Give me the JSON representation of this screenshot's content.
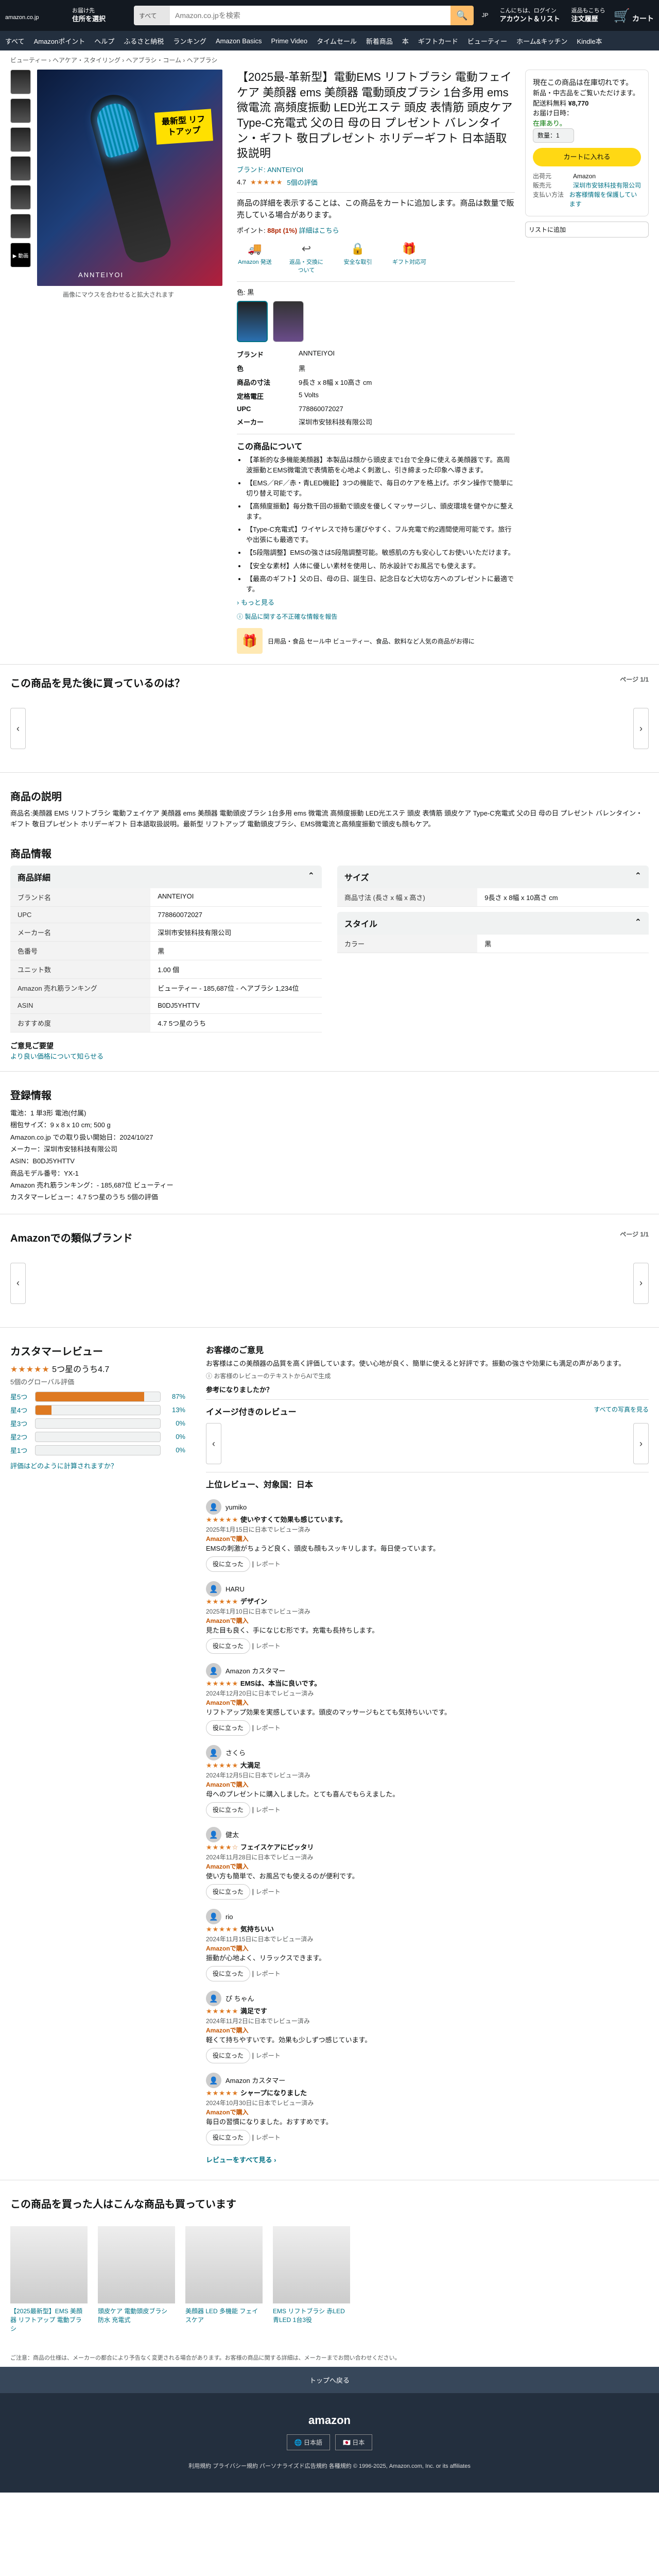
{
  "header": {
    "logo": "amazon",
    "logo_suffix": ".co.jp",
    "deliver_line1": "お届け先",
    "deliver_line2": "住所を選択",
    "search_category": "すべて",
    "search_placeholder": "Amazon.co.jpを検索",
    "lang": "JP",
    "account_line1": "こんにちは、ログイン",
    "account_line2": "アカウント＆リスト",
    "orders_line1": "返品もこちら",
    "orders_line2": "注文履歴",
    "cart": "カート"
  },
  "nav": [
    "すべて",
    "Amazonポイント",
    "ヘルプ",
    "ふるさと納税",
    "ランキング",
    "Amazon Basics",
    "Prime Video",
    "タイムセール",
    "新着商品",
    "本",
    "ギフトカード",
    "ビューティー",
    "ホーム&キッチン",
    "Kindle本"
  ],
  "breadcrumb": "ビューティー › ヘアケア・スタイリング › ヘアブラシ・コーム › ヘアブラシ",
  "gallery": {
    "thumb_video": "▶ 動画",
    "tag": "最新型 リフトアップ",
    "brand": "ANNTEIYOI",
    "hover": "画像にマウスを合わせると拡大されます"
  },
  "product": {
    "title": "【2025最-革新型】電動EMS リフトブラシ 電動フェイケア 美顔器 ems 美顔器 電動頭皮ブラシ 1台多用 ems 微電流 高頻度振動 LED光エステ 頭皮 表情筋 頭皮ケア Type-C充電式 父の日 母の日 プレゼント バレンタイン・ギフト 敬日プレゼント ホリデーギフト 日本語取扱説明",
    "visit": "ブランド: ANNTEIYOI",
    "rating": "4.7",
    "rating_count": "5個の評価",
    "unavailable": "商品の詳細を表示することは、この商品をカートに追加します。商品は数量で販売している場合があります。",
    "points_label": "ポイント:",
    "points_value": "88pt (1%)",
    "points_note": "詳細はこちら",
    "icons": [
      {
        "icon": "truck-icon",
        "glyph": "🚚",
        "label": "Amazon 発送"
      },
      {
        "icon": "return-icon",
        "glyph": "↩",
        "label": "返品・交換について"
      },
      {
        "icon": "lock-icon",
        "glyph": "🔒",
        "label": "安全な取引"
      },
      {
        "icon": "gift-icon",
        "glyph": "🎁",
        "label": "ギフト対応可"
      }
    ],
    "color_label": "色: 黒"
  },
  "specs": [
    {
      "k": "ブランド",
      "v": "ANNTEIYOI"
    },
    {
      "k": "色",
      "v": "黒"
    },
    {
      "k": "商品の寸法",
      "v": "9長さ x 8幅 x 10高さ cm"
    },
    {
      "k": "定格電圧",
      "v": "5 Volts"
    },
    {
      "k": "UPC",
      "v": "778860072027"
    },
    {
      "k": "メーカー",
      "v": "深圳市安铱科技有限公司"
    }
  ],
  "about": {
    "heading": "この商品について",
    "items": [
      "【革新的な多機能美顔器】本製品は顔から頭皮まで1台で全身に使える美顔器です。高周波振動とEMS微電流で表情筋を心地よく刺激し、引き締まった印象へ導きます。",
      "【EMS／RF／赤・青LED機能】3つの機能で、毎日のケアを格上げ。ボタン操作で簡単に切り替え可能です。",
      "【高頻度振動】毎分数千回の振動で頭皮を優しくマッサージし、頭皮環境を健やかに整えます。",
      "【Type-C充電式】ワイヤレスで持ち運びやすく、フル充電で約2週間使用可能です。旅行や出張にも最適です。",
      "【5段階調整】EMSの強さは5段階調整可能。敏感肌の方も安心してお使いいただけます。",
      "【安全な素材】人体に優しい素材を使用し、防水設計でお風呂でも使えます。",
      "【最高のギフト】父の日、母の日、誕生日、記念日など大切な方へのプレゼントに最適です。"
    ],
    "more": "› もっと見る",
    "report": "ⓘ 製品に関する不正確な情報を報告"
  },
  "promo": {
    "glyph": "🎁",
    "text": "日用品・食品 セール中 ビューティー、食品、飲料など人気の商品がお得に"
  },
  "buybox": {
    "line1": "現在この商品は在庫切れです。",
    "line2": "新品・中古品をご覧いただけます。",
    "price_label": "配送料無料",
    "price": "¥8,770",
    "delivery": "お届け日時：",
    "stock": "在庫あり。",
    "qty": "数量：1",
    "cart_button": "カートに入れる",
    "ship_from_k": "出荷元",
    "ship_from_v": "Amazon",
    "seller_k": "販売元",
    "seller_v": "深圳市安铱科技有限公司",
    "pay_k": "支払い方法",
    "pay_v": "お客様情報を保護しています",
    "wish": "リストに追加"
  },
  "sections": {
    "similar": "この商品を見た後に買っているのは？",
    "similar_page": "ページ 1/1",
    "desc_heading": "商品の説明",
    "desc_text": "商品名:美顔器 EMS リフトブラシ 電動フェイケア 美顔器 ems 美顔器 電動頭皮ブラシ 1台多用 ems 微電流 高頻度振動 LED光エステ 頭皮 表情筋 頭皮ケア Type-C充電式 父の日 母の日 プレゼント バレンタイン・ギフト 敬日プレゼント ホリデーギフト 日本語取扱説明。最新型 リフトアップ 電動頭皮ブラシ、EMS微電流と高頻度振動で頭皮も顔もケア。",
    "info_heading": "商品情報",
    "detail_heading": "商品詳細",
    "size_heading": "サイズ",
    "style_heading": "スタイル",
    "extra_heading": "ご意見ご要望",
    "extra_link": "より良い価格について知らせる",
    "reg_heading": "登録情報",
    "related_brand": "Amazonでの類似ブランド",
    "related_page": "ページ 1/1"
  },
  "details": [
    {
      "k": "ブランド名",
      "v": "ANNTEIYOI"
    },
    {
      "k": "UPC",
      "v": "778860072027"
    },
    {
      "k": "メーカー名",
      "v": "深圳市安铱科技有限公司"
    },
    {
      "k": "色番号",
      "v": "黒"
    },
    {
      "k": "ユニット数",
      "v": "1.00 個"
    },
    {
      "k": "Amazon 売れ筋ランキング",
      "v": "ビューティー - 185,687位 - ヘアブラシ 1,234位"
    },
    {
      "k": "ASIN",
      "v": "B0DJ5YHTTV"
    },
    {
      "k": "おすすめ度",
      "v": "4.7 5つ星のうち"
    }
  ],
  "size_rows": [
    {
      "k": "商品寸法 (長さ x 幅 x 高さ)",
      "v": "9長さ x 8幅 x 10高さ cm"
    }
  ],
  "style_rows": [
    {
      "k": "カラー",
      "v": "黒"
    }
  ],
  "registration": [
    "電池：1 単3形 電池(付属)",
    "梱包サイズ：9 x 8 x 10 cm; 500 g",
    "Amazon.co.jp での取り扱い開始日：2024/10/27",
    "メーカー：深圳市安铱科技有限公司",
    "ASIN：B0DJ5YHTTV",
    "商品モデル番号：YX-1",
    "Amazon 売れ筋ランキング：- 185,687位 ビューティー",
    "カスタマーレビュー：4.7 5つ星のうち 5個の評価"
  ],
  "reviews": {
    "heading": "カスタマーレビュー",
    "score": "5つ星のうち4.7",
    "count": "5個のグローバル評価",
    "bars": [
      {
        "label": "星5つ",
        "pct": "87%",
        "fill": 0.87
      },
      {
        "label": "星4つ",
        "pct": "13%",
        "fill": 0.13
      },
      {
        "label": "星3つ",
        "pct": "0%",
        "fill": 0
      },
      {
        "label": "星2つ",
        "pct": "0%",
        "fill": 0
      },
      {
        "label": "星1つ",
        "pct": "0%",
        "fill": 0
      }
    ],
    "how_link": "評価はどのように計算されますか？",
    "summary_heading": "お客様のご意見",
    "summary_text": "お客様はこの美顔器の品質を高く評価しています。使い心地が良く、簡単に使えると好評です。振動の強さや効果にも満足の声があります。",
    "generated": "ⓘ お客様のレビューのテキストからAIで生成",
    "helpful_q": "参考になりましたか？",
    "image_heading": "イメージ付きのレビュー",
    "image_link": "すべての写真を見る",
    "top_heading": "上位レビュー、対象国：日本",
    "items": [
      {
        "name": "yumiko",
        "stars": "★★★★★",
        "title": "使いやすくて効果も感じています。",
        "meta": "2025年1月15日に日本でレビュー済み",
        "vp": "Amazonで購入",
        "body": "EMSの刺激がちょうど良く、頭皮も顔もスッキリします。毎日使っています。"
      },
      {
        "name": "HARU",
        "stars": "★★★★★",
        "title": "デザイン",
        "meta": "2025年1月10日に日本でレビュー済み",
        "vp": "Amazonで購入",
        "body": "見た目も良く、手になじむ形です。充電も長持ちします。"
      },
      {
        "name": "Amazon カスタマー",
        "stars": "★★★★★",
        "title": "EMSは、本当に良いです。",
        "meta": "2024年12月20日に日本でレビュー済み",
        "vp": "Amazonで購入",
        "body": "リフトアップ効果を実感しています。頭皮のマッサージもとても気持ちいいです。"
      },
      {
        "name": "さくら",
        "stars": "★★★★★",
        "title": "大満足",
        "meta": "2024年12月5日に日本でレビュー済み",
        "vp": "Amazonで購入",
        "body": "母へのプレゼントに購入しました。とても喜んでもらえました。"
      },
      {
        "name": "健太",
        "stars": "★★★★☆",
        "title": "フェイスケアにピッタリ",
        "meta": "2024年11月28日に日本でレビュー済み",
        "vp": "Amazonで購入",
        "body": "使い方も簡単で、お風呂でも使えるのが便利です。"
      },
      {
        "name": "rio",
        "stars": "★★★★★",
        "title": "気持ちいい",
        "meta": "2024年11月15日に日本でレビュー済み",
        "vp": "Amazonで購入",
        "body": "振動が心地よく、リラックスできます。"
      },
      {
        "name": "ぴ ちゃん",
        "stars": "★★★★★",
        "title": "満足です",
        "meta": "2024年11月2日に日本でレビュー済み",
        "vp": "Amazonで購入",
        "body": "軽くて持ちやすいです。効果も少しずつ感じています。"
      },
      {
        "name": "Amazon カスタマー",
        "stars": "★★★★★",
        "title": "シャープになりました",
        "meta": "2024年10月30日に日本でレビュー済み",
        "vp": "Amazonで購入",
        "body": "毎日の習慣になりました。おすすめです。"
      }
    ],
    "helpful_btn": "役に立った",
    "report_btn": "レポート",
    "more_reviews": "レビューをすべて見る ›"
  },
  "also_bought": {
    "heading": "この商品を買った人はこんな商品も買っています",
    "items": [
      "【2025最新型】EMS 美顔器 リフトアップ 電動ブラシ",
      "頭皮ケア 電動頭皮ブラシ 防水 充電式",
      "美顔器 LED 多機能 フェイスケア",
      "EMS リフトブラシ 赤LED 青LED 1台3役"
    ]
  },
  "disclaimer": "ご注意：商品の仕様は、メーカーの都合により予告なく変更される場合があります。お客様の商品に関する詳細は、メーカーまでお問い合わせください。",
  "footer": {
    "back_top": "トップへ戻る",
    "logo": "amazon",
    "lang_btn": "🌐 日本語",
    "country_btn": "🇯🇵 日本",
    "links": "利用規約  プライバシー規約  パーソナライズド広告規約  各種規約  © 1996-2025, Amazon.com, Inc. or its affiliates"
  }
}
